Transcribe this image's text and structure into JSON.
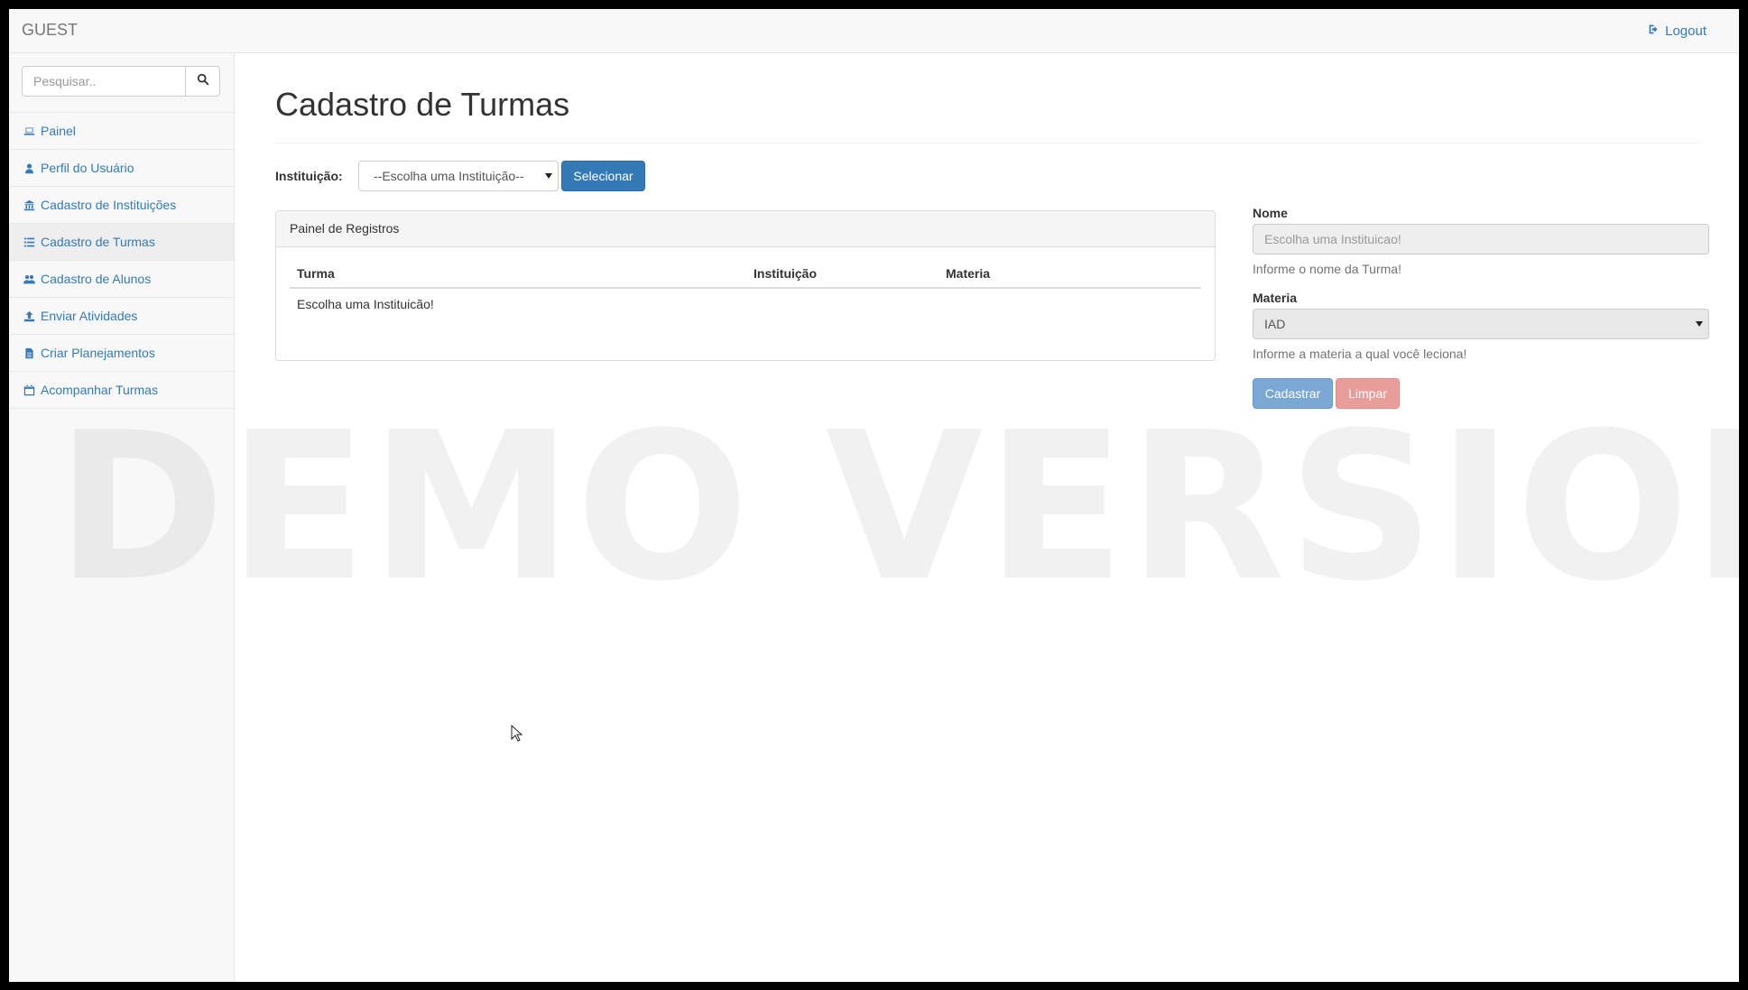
{
  "navbar": {
    "brand": "GUEST",
    "logout_label": "Logout"
  },
  "sidebar": {
    "search_placeholder": "Pesquisar..",
    "items": [
      {
        "label": "Painel",
        "icon": "laptop-icon"
      },
      {
        "label": "Perfil do Usuário",
        "icon": "user-icon"
      },
      {
        "label": "Cadastro de Instituições",
        "icon": "bank-icon"
      },
      {
        "label": "Cadastro de Turmas",
        "icon": "list-icon",
        "active": true
      },
      {
        "label": "Cadastro de Alunos",
        "icon": "users-icon"
      },
      {
        "label": "Enviar Atividades",
        "icon": "upload-icon"
      },
      {
        "label": "Criar Planejamentos",
        "icon": "file-text-icon"
      },
      {
        "label": "Acompanhar Turmas",
        "icon": "calendar-icon"
      }
    ]
  },
  "main": {
    "title": "Cadastro de Turmas",
    "instituicao_label": "Instituição:",
    "instituicao_selected": "--Escolha uma Instituição--",
    "selecionar_label": "Selecionar",
    "panel": {
      "heading": "Painel de Registros",
      "columns": [
        "Turma",
        "Instituição",
        "Materia"
      ],
      "empty_message": "Escolha uma Instituicão!"
    },
    "form": {
      "nome_label": "Nome",
      "nome_placeholder": "Escolha uma Instituicao!",
      "nome_help": "Informe o nome da Turma!",
      "materia_label": "Materia",
      "materia_selected": "IAD",
      "materia_help": "Informe a materia a qual você leciona!",
      "cadastrar_label": "Cadastrar",
      "limpar_label": "Limpar"
    }
  },
  "watermark": "DEMO VERSION",
  "colors": {
    "link": "#337ab7",
    "primary_button": "#337ab7",
    "cadastrar_button": "#7aa7d4",
    "limpar_button": "#e99d9a"
  }
}
